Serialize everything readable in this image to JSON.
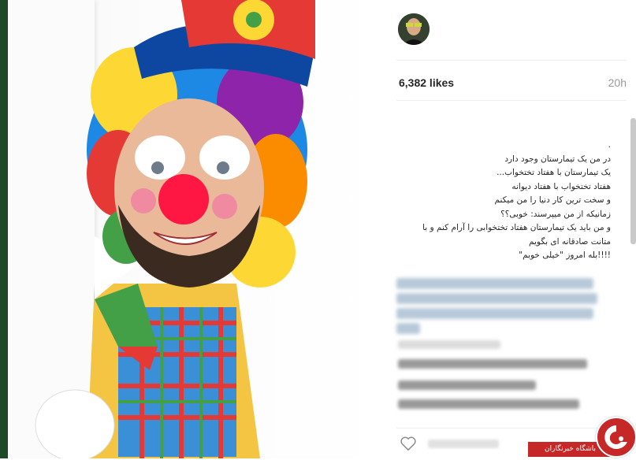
{
  "post": {
    "likes": "6,382 likes",
    "time": "20h",
    "caption_lines": [
      ".",
      "در من یک تیمارستان وجود دارد",
      "یک تیمارستان با هفتاد تختخواب...",
      "هفتاد تختخواب با هفتاد دیوانه",
      "و سخت ترین کار دنیا را من میکنم",
      "زمانیکه از من میپرسند: خوبی؟؟",
      "و من باید یک تیمارستان هفتاد تختخوابی را آرام کنم و با",
      "متانت صادقانه ای بگویم",
      "!!!!بله امروز \"خیلی خوبم\""
    ]
  },
  "colors": {
    "likes_text": "#262626",
    "meta_text": "#999999",
    "hashtag": "#3f729b",
    "badge_red": "#c62828"
  },
  "icons": {
    "avatar": "avatar-photo",
    "heart": "heart-icon",
    "watermark": "news-agency-logo-icon"
  },
  "watermark": {
    "label": "باشگاه خبرنگاران"
  }
}
